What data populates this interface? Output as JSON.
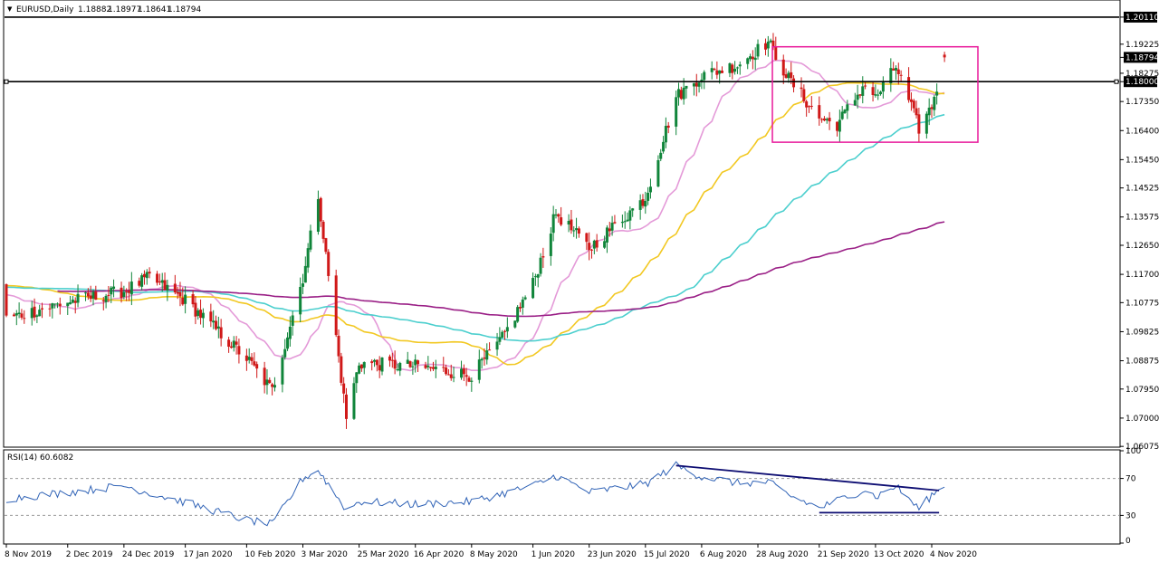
{
  "header": {
    "menu_glyph": "▼",
    "symbol": "EURUSD,Daily",
    "ohlc": [
      "1.18882",
      "1.18977",
      "1.18641",
      "1.18794"
    ]
  },
  "rsi_header": {
    "label": "RSI(14) 60.6082"
  },
  "colors": {
    "bull": "#10853a",
    "bear": "#d01818",
    "ma_pink": "#e49ad8",
    "ma_yellow": "#f2c822",
    "ma_teal": "#4ccfce",
    "ma_purple": "#9a1f86",
    "box": "#e8199a",
    "rsi_line": "#2f62b6",
    "rsi_trend": "#0d0d72"
  },
  "chart_data": [
    {
      "type": "candlestick",
      "panel": "price",
      "title": "EURUSD,Daily",
      "ylim": [
        1.0608,
        1.2064
      ],
      "y_ticks": [
        "1.20110",
        "1.19225",
        "1.18794",
        "1.18275",
        "1.18000",
        "1.17350",
        "1.16400",
        "1.15450",
        "1.14525",
        "1.13575",
        "1.12650",
        "1.11700",
        "1.10775",
        "1.09825",
        "1.08875",
        "1.07950",
        "1.07000",
        "1.06075"
      ],
      "y_tick_values": [
        1.2011,
        1.19225,
        1.18794,
        1.18275,
        1.18,
        1.1735,
        1.164,
        1.1545,
        1.14525,
        1.13575,
        1.1265,
        1.117,
        1.10775,
        1.09825,
        1.08875,
        1.0795,
        1.07,
        1.06075
      ],
      "highlighted_ticks": [
        "1.20110",
        "1.18794",
        "1.18000"
      ],
      "x_tick_labels": [
        "8 Nov 2019",
        "2 Dec 2019",
        "24 Dec 2019",
        "17 Jan 2020",
        "10 Feb 2020",
        "3 Mar 2020",
        "25 Mar 2020",
        "16 Apr 2020",
        "8 May 2020",
        "1 Jun 2020",
        "23 Jun 2020",
        "15 Jul 2020",
        "6 Aug 2020",
        "28 Aug 2020",
        "21 Sep 2020",
        "13 Oct 2020",
        "4 Nov 2020"
      ],
      "close_anchors": [
        [
          "8 Nov 2019",
          1.1025
        ],
        [
          "2 Dec 2019",
          1.108
        ],
        [
          "24 Dec 2019",
          1.1115
        ],
        [
          "3 Jan 2020",
          1.116
        ],
        [
          "17 Jan 2020",
          1.1085
        ],
        [
          "10 Feb 2020",
          1.0895
        ],
        [
          "20 Feb 2020",
          1.079
        ],
        [
          "3 Mar 2020",
          1.116
        ],
        [
          "9 Mar 2020",
          1.143
        ],
        [
          "20 Mar 2020",
          1.07
        ],
        [
          "25 Mar 2020",
          1.088
        ],
        [
          "16 Apr 2020",
          1.087
        ],
        [
          "8 May 2020",
          1.084
        ],
        [
          "20 May 2020",
          1.096
        ],
        [
          "1 Jun 2020",
          1.114
        ],
        [
          "10 Jun 2020",
          1.137
        ],
        [
          "23 Jun 2020",
          1.1255
        ],
        [
          "15 Jul 2020",
          1.142
        ],
        [
          "27 Jul 2020",
          1.175
        ],
        [
          "6 Aug 2020",
          1.182
        ],
        [
          "20 Aug 2020",
          1.1855
        ],
        [
          "1 Sep 2020",
          1.193
        ],
        [
          "9 Sep 2020",
          1.181
        ],
        [
          "21 Sep 2020",
          1.168
        ],
        [
          "28 Sep 2020",
          1.166
        ],
        [
          "9 Oct 2020",
          1.1795
        ],
        [
          "13 Oct 2020",
          1.1745
        ],
        [
          "21 Oct 2020",
          1.185
        ],
        [
          "30 Oct 2020",
          1.1647
        ],
        [
          "4 Nov 2020",
          1.172
        ],
        [
          "9 Nov 2020",
          1.18794
        ]
      ],
      "last_ohlc": {
        "open": 1.18882,
        "high": 1.18977,
        "low": 1.18641,
        "close": 1.18794
      },
      "lines": [
        {
          "kind": "horizontal",
          "value": 1.2011
        },
        {
          "kind": "horizontal",
          "value": 1.18,
          "extends": "full-width"
        }
      ],
      "range_box": {
        "from": "28 Aug 2020",
        "to": "4 Nov 2020",
        "high": 1.1914,
        "low": 1.1602
      },
      "moving_averages": [
        {
          "color_key": "ma_pink",
          "period": 20
        },
        {
          "color_key": "ma_yellow",
          "period": 50
        },
        {
          "color_key": "ma_teal",
          "period": 100
        },
        {
          "color_key": "ma_purple",
          "period": 200
        }
      ]
    },
    {
      "type": "line",
      "panel": "indicator",
      "title": "RSI(14) 60.6082",
      "ylim": [
        0,
        100
      ],
      "y_ticks": [
        "100",
        "70",
        "30",
        "0"
      ],
      "levels": [
        70,
        30
      ],
      "last_value": 60.6082,
      "rsi_anchors": [
        [
          "8 Nov 2019",
          48
        ],
        [
          "2 Dec 2019",
          55
        ],
        [
          "24 Dec 2019",
          62
        ],
        [
          "17 Jan 2020",
          44
        ],
        [
          "10 Feb 2020",
          25
        ],
        [
          "20 Feb 2020",
          20
        ],
        [
          "3 Mar 2020",
          70
        ],
        [
          "9 Mar 2020",
          79
        ],
        [
          "20 Mar 2020",
          36
        ],
        [
          "25 Mar 2020",
          45
        ],
        [
          "16 Apr 2020",
          42
        ],
        [
          "8 May 2020",
          45
        ],
        [
          "1 Jun 2020",
          62
        ],
        [
          "10 Jun 2020",
          73
        ],
        [
          "23 Jun 2020",
          55
        ],
        [
          "15 Jul 2020",
          64
        ],
        [
          "27 Jul 2020",
          84
        ],
        [
          "6 Aug 2020",
          72
        ],
        [
          "20 Aug 2020",
          65
        ],
        [
          "1 Sep 2020",
          66
        ],
        [
          "9 Sep 2020",
          52
        ],
        [
          "21 Sep 2020",
          38
        ],
        [
          "28 Sep 2020",
          46
        ],
        [
          "9 Oct 2020",
          58
        ],
        [
          "13 Oct 2020",
          50
        ],
        [
          "21 Oct 2020",
          62
        ],
        [
          "30 Oct 2020",
          37
        ],
        [
          "4 Nov 2020",
          52
        ],
        [
          "9 Nov 2020",
          60.6082
        ]
      ],
      "trendlines": [
        {
          "from": [
            "27 Jul 2020",
            84
          ],
          "to": [
            "9 Nov 2020",
            57
          ]
        },
        {
          "from": [
            "21 Sep 2020",
            33
          ],
          "to": [
            "9 Nov 2020",
            33
          ]
        }
      ]
    }
  ]
}
